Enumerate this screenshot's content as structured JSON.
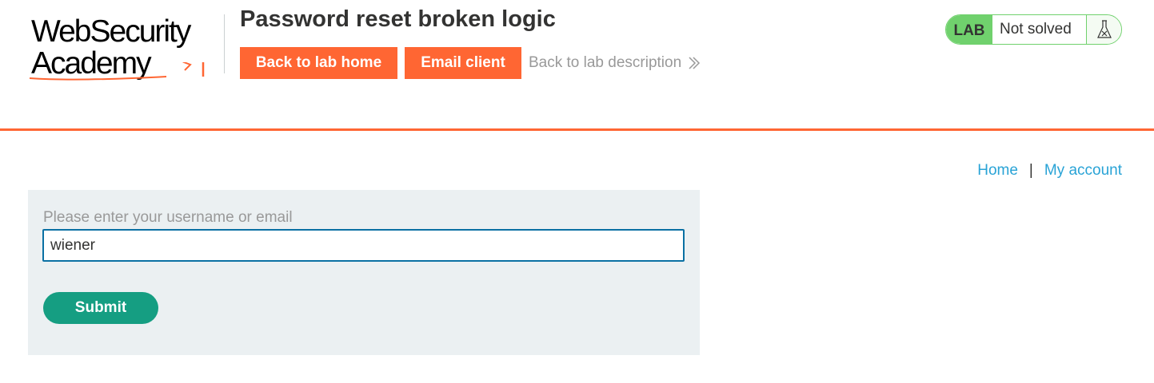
{
  "logo": {
    "line1": "WebSecurity",
    "line2": "Academy"
  },
  "lab": {
    "title": "Password reset broken logic",
    "badge": "LAB",
    "status": "Not solved"
  },
  "header_buttons": {
    "back_home": "Back to lab home",
    "email_client": "Email client",
    "back_description": "Back to lab description"
  },
  "nav": {
    "home": "Home",
    "separator": "|",
    "my_account": "My account"
  },
  "form": {
    "label": "Please enter your username or email",
    "value": "wiener",
    "submit": "Submit"
  },
  "colors": {
    "accent_orange": "#ff6633",
    "status_green": "#70d16d",
    "submit_teal": "#159e82",
    "link_blue": "#29a3d6",
    "input_border": "#0a70a3",
    "panel_bg": "#ebf0f2"
  },
  "icons": {
    "back_description": "double-chevron-right-icon",
    "status": "flask-icon"
  }
}
